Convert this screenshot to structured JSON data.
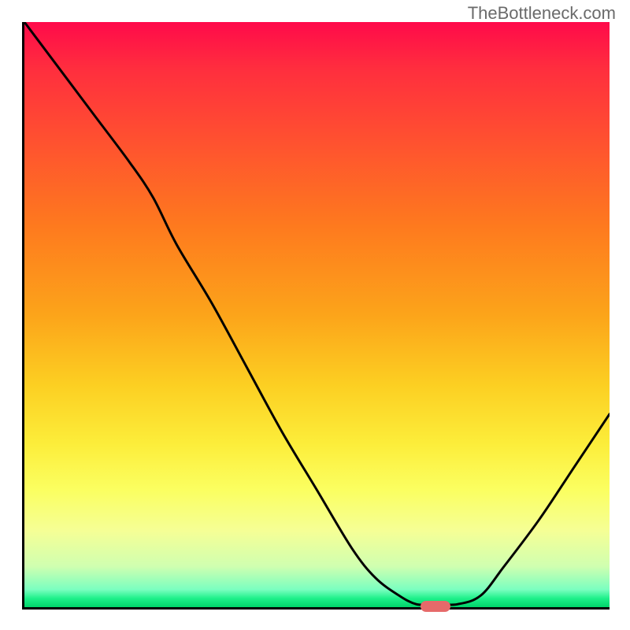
{
  "watermark": "TheBottleneck.com",
  "chart_data": {
    "type": "line",
    "title": "",
    "xlabel": "",
    "ylabel": "",
    "xlim": [
      0,
      100
    ],
    "ylim": [
      0,
      100
    ],
    "grid": false,
    "series": [
      {
        "name": "curve",
        "x": [
          0,
          6,
          12,
          18,
          22,
          26,
          32,
          38,
          44,
          50,
          56,
          60,
          64,
          67,
          70,
          74,
          78,
          82,
          88,
          94,
          100
        ],
        "y": [
          100,
          92,
          84,
          76,
          70,
          62,
          52,
          41,
          30,
          20,
          10,
          5,
          2,
          0.5,
          0.5,
          0.5,
          2,
          7,
          15,
          24,
          33
        ]
      }
    ],
    "marker": {
      "x": 70,
      "y": 0.5
    },
    "background_gradient_stops": [
      {
        "pos": 0,
        "color": "#ff0a4a"
      },
      {
        "pos": 8,
        "color": "#ff2e3e"
      },
      {
        "pos": 20,
        "color": "#ff5030"
      },
      {
        "pos": 35,
        "color": "#fe7a1e"
      },
      {
        "pos": 50,
        "color": "#fca41a"
      },
      {
        "pos": 62,
        "color": "#fccf22"
      },
      {
        "pos": 72,
        "color": "#fced3a"
      },
      {
        "pos": 80,
        "color": "#fbff61"
      },
      {
        "pos": 87,
        "color": "#f5ff96"
      },
      {
        "pos": 93,
        "color": "#d0ffb0"
      },
      {
        "pos": 97,
        "color": "#7affc0"
      },
      {
        "pos": 98.5,
        "color": "#1ef08a"
      },
      {
        "pos": 100,
        "color": "#00d46a"
      }
    ]
  }
}
